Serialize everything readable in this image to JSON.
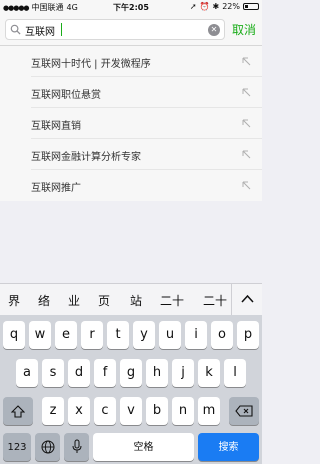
{
  "status": {
    "carrier": "中国联通",
    "network": "4G",
    "time": "下午2:05",
    "battery": "22%"
  },
  "search": {
    "query": "互联网",
    "cancel_label": "取消"
  },
  "suggestions": [
    "互联网十时代 | 开发微程序",
    "互联网职位悬赏",
    "互联网直销",
    "互联网金融计算分析专家",
    "互联网推广"
  ],
  "candidates": [
    "界",
    "络",
    "业",
    "页",
    "站",
    "二十",
    "二十"
  ],
  "keyboard": {
    "row1": [
      "q",
      "w",
      "e",
      "r",
      "t",
      "y",
      "u",
      "i",
      "o",
      "p"
    ],
    "row2": [
      "a",
      "s",
      "d",
      "f",
      "g",
      "h",
      "j",
      "k",
      "l"
    ],
    "row3": [
      "z",
      "x",
      "c",
      "v",
      "b",
      "n",
      "m"
    ],
    "numbers_label": "123",
    "space_label": "空格",
    "search_label": "搜索"
  },
  "colors": {
    "accent": "#1aad19",
    "search_key": "#1a7cf3"
  }
}
